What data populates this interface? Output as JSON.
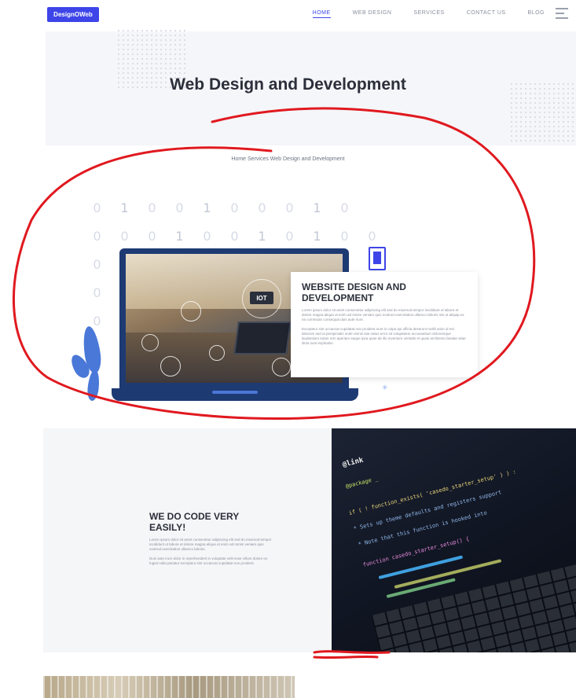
{
  "header": {
    "logo_text": "DesignOWeb",
    "nav": [
      {
        "label": "HOME",
        "active": true
      },
      {
        "label": "WEB DESIGN"
      },
      {
        "label": "SERVICES"
      },
      {
        "label": "CONTACT US"
      },
      {
        "label": "BLOG"
      }
    ]
  },
  "hero": {
    "title": "Web Design and Development"
  },
  "breadcrumb": "Home Services Web Design and Development",
  "binary": {
    "rows": [
      [
        "0",
        "1",
        "0",
        "0",
        "1",
        "0",
        "0",
        "0",
        "1",
        "0"
      ],
      [
        "0",
        "0",
        "0",
        "1",
        "0",
        "0",
        "1",
        "0",
        "1",
        "0",
        "0"
      ],
      [
        "0"
      ],
      [
        "0"
      ],
      [
        "0"
      ]
    ]
  },
  "illustration": {
    "iot_label": "IOT"
  },
  "card": {
    "title": "WEBSITE DESIGN AND DEVELOPMENT",
    "para1": "Lorem ipsum dolor sit amet consectetur adipiscing elit sed do eiusmod tempor incididunt ut labore et dolore magna aliqua ut enim ad minim veniam quis nostrud exercitation ullamco laboris nisi ut aliquip ex ea commodo consequat duis aute irure.",
    "para2": "Excepteur sint occaecat cupidatat non proident sunt in culpa qui officia deserunt mollit anim id est laborum sed ut perspiciatis unde omnis iste natus error sit voluptatem accusantium doloremque laudantium totam rem aperiam eaque ipsa quae ab illo inventore veritatis et quasi architecto beatae vitae dicta sunt explicabo."
  },
  "code_section": {
    "title": "WE DO CODE VERY EASILY!",
    "para1": "Lorem ipsum dolor sit amet consectetur adipiscing elit sed do eiusmod tempor incididunt ut labore et dolore magna aliqua ut enim ad minim veniam quis nostrud exercitation ullamco laboris.",
    "para2": "Duis aute irure dolor in reprehenderit in voluptate velit esse cillum dolore eu fugiat nulla pariatur excepteur sint occaecat cupidatat non proident."
  },
  "code_image": {
    "lines": [
      "@link",
      "@package _",
      "if ( ! function_exists( 'casedo_starter_setup' ) ) :",
      "* Sets up theme defaults and registers support",
      "* Note that this function is hooked into",
      "function casedo_starter_setup() {"
    ]
  },
  "colors": {
    "accent": "#3d45e8",
    "annotation": "#e0191f",
    "laptop": "#1e3a73"
  }
}
